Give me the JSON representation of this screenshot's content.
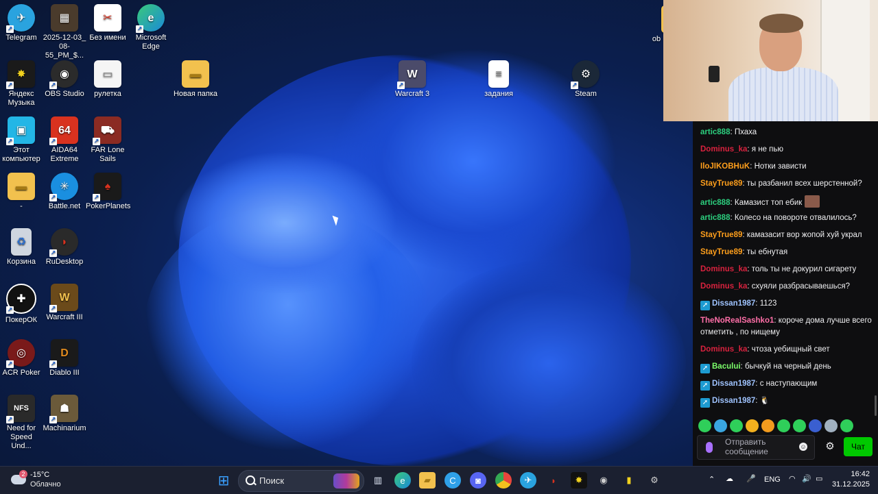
{
  "desktop": {
    "icons": [
      {
        "label": "Telegram",
        "glyph": "✈",
        "bg": "#2aa3df"
      },
      {
        "label": "2025-12-03_ 08-55_PM_$...",
        "glyph": "▦",
        "bg": "#4a3b2c"
      },
      {
        "label": "Без имени",
        "glyph": "✂",
        "bg": "#ffffff"
      },
      {
        "label": "Microsoft Edge",
        "glyph": "e",
        "bg": "#1b8ad8"
      },
      {
        "label": "Новая папка",
        "glyph": "📁",
        "bg": "#f2c14e"
      },
      {
        "label": "Яндекс Музыка",
        "glyph": "✸",
        "bg": "#1a1a1a"
      },
      {
        "label": "OBS Studio",
        "glyph": "◉",
        "bg": "#2b2b2b"
      },
      {
        "label": "рулетка",
        "glyph": "▭",
        "bg": "#f5f5f5"
      },
      {
        "label": "Warcraft 3",
        "glyph": "W",
        "bg": "#4b4b6a"
      },
      {
        "label": "задания",
        "glyph": "≡",
        "bg": "#ffffff"
      },
      {
        "label": "Steam",
        "glyph": "⚙",
        "bg": "#1b2838"
      },
      {
        "label": "Этот компьютер",
        "glyph": "▣",
        "bg": "#23b6e6"
      },
      {
        "label": "AIDA64 Extreme",
        "glyph": "64",
        "bg": "#d8321f"
      },
      {
        "label": "FAR Lone Sails",
        "glyph": "⛟",
        "bg": "#8b2b23"
      },
      {
        "label": "-",
        "glyph": "📁",
        "bg": "#f2c14e"
      },
      {
        "label": "Battle.net",
        "glyph": "✳",
        "bg": "#1a8fe0"
      },
      {
        "label": "PokerPlanets",
        "glyph": "♠",
        "bg": "#1a1a1a"
      },
      {
        "label": "Корзина",
        "glyph": "♻",
        "bg": "#cfd6df"
      },
      {
        "label": "RuDesktop",
        "glyph": "◗",
        "bg": "#2a2a2a"
      },
      {
        "label": "ПокерОК",
        "glyph": "✚",
        "bg": "#111111"
      },
      {
        "label": "Warcraft III",
        "glyph": "W",
        "bg": "#6b4a1a"
      },
      {
        "label": "ACR Poker",
        "glyph": "◎",
        "bg": "#7a1a1a"
      },
      {
        "label": "Diablo III",
        "glyph": "D",
        "bg": "#1a1a1a"
      },
      {
        "label": "Need for Speed Und...",
        "glyph": "NFS",
        "bg": "#2a2a2a"
      },
      {
        "label": "Machinarium",
        "glyph": "☗",
        "bg": "#6b5a3a"
      }
    ],
    "partial_icon_label": "ob"
  },
  "chat": {
    "messages": [
      {
        "user": "artic888",
        "color": "#2ccf7e",
        "text": "Пхаха",
        "badge": false
      },
      {
        "user": "Dominus_ka",
        "color": "#d8223e",
        "text": "я не пью",
        "badge": false
      },
      {
        "user": "IloJIKOBHuK",
        "color": "#ff9f1c",
        "text": "Нотки зависти",
        "badge": false
      },
      {
        "user": "StayTrue89",
        "color": "#ff9f1c",
        "text": "ты разбанил всех шерстенной?",
        "badge": false
      },
      {
        "user": "artic888",
        "color": "#2ccf7e",
        "text": "Камазист топ ебик",
        "badge": false
      },
      {
        "user": "artic888",
        "color": "#2ccf7e",
        "text": "Колесо на повороте отвалилось?",
        "badge": false
      },
      {
        "user": "StayTrue89",
        "color": "#ff9f1c",
        "text": "камазасит вор жопой хуй украл",
        "badge": false
      },
      {
        "user": "StayTrue89",
        "color": "#ff9f1c",
        "text": "ты ебнутая",
        "badge": false
      },
      {
        "user": "Dominus_ka",
        "color": "#d8223e",
        "text": "толь ты не докурил сигарету",
        "badge": false
      },
      {
        "user": "Dominus_ka",
        "color": "#d8223e",
        "text": "схуяли разбрасываешься?",
        "badge": false
      },
      {
        "user": "Dissan1987",
        "color": "#9fc3ff",
        "text": "1123",
        "badge": true
      },
      {
        "user": "TheNoRealSashko1",
        "color": "#ff6fa8",
        "text": "короче дома лучше всего отметить , по нищему",
        "badge": false
      },
      {
        "user": "Dominus_ka",
        "color": "#d8223e",
        "text": "чтоза уебищный свет",
        "badge": false
      },
      {
        "user": "Bacului",
        "color": "#7cff6b",
        "text": "бычкуй на черный день",
        "badge": true
      },
      {
        "user": "Dissan1987",
        "color": "#9fc3ff",
        "text": "с наступающим",
        "badge": true
      },
      {
        "user": "Dissan1987",
        "color": "#9fc3ff",
        "text": "🐧",
        "badge": true
      }
    ],
    "input_placeholder": "Отправить сообщение",
    "send_label": "Чат",
    "emote_colors": [
      "#2fcf5a",
      "#3aa6e0",
      "#2fcf5a",
      "#f2b01e",
      "#f29b1e",
      "#2fcf5a",
      "#2fcf5a",
      "#3a5fd0",
      "#a0b0c0",
      "#2fcf5a"
    ]
  },
  "taskbar": {
    "weather_temp": "-15°C",
    "weather_cond": "Облачно",
    "weather_alert": "2",
    "search_label": "Поиск",
    "lang": "ENG",
    "time": "16:42",
    "date": "31.12.2025",
    "apps": [
      {
        "name": "windows-start-icon",
        "glyph": "⊞",
        "color": "#3aa0ff"
      },
      {
        "name": "task-view-icon",
        "glyph": "▥",
        "color": "#dfe6f5"
      },
      {
        "name": "edge-icon",
        "glyph": "e",
        "color": "#1b8ad8"
      },
      {
        "name": "file-explorer-icon",
        "glyph": "▰",
        "color": "#f2c14e"
      },
      {
        "name": "browser-c-icon",
        "glyph": "C",
        "color": "#2fa0e8"
      },
      {
        "name": "discord-icon",
        "glyph": "◙",
        "color": "#5865f2"
      },
      {
        "name": "chrome-icon",
        "glyph": "◍",
        "color": "#e8453c"
      },
      {
        "name": "telegram-icon",
        "glyph": "✈",
        "color": "#2aa3df"
      },
      {
        "name": "rudesktop-icon",
        "glyph": "◗",
        "color": "#d8321f"
      },
      {
        "name": "yandex-music-icon",
        "glyph": "✸",
        "color": "#f2d21e"
      },
      {
        "name": "obs-icon",
        "glyph": "◉",
        "color": "#a0a0a0"
      },
      {
        "name": "pin-app-icon",
        "glyph": "▮",
        "color": "#f2d21e"
      },
      {
        "name": "settings-app-icon",
        "glyph": "⚙",
        "color": "#d0d0d0"
      }
    ]
  }
}
